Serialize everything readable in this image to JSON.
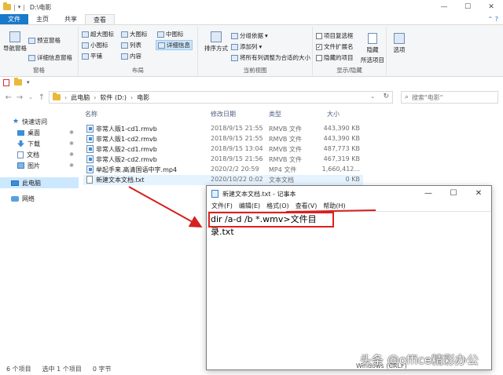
{
  "window": {
    "title": "D:\\电影"
  },
  "ribbon_tabs": [
    "文件",
    "主页",
    "共享",
    "查看"
  ],
  "ribbon": {
    "panes": {
      "nav_pane": "导航窗格",
      "preview": "预览窗格",
      "details": "详细信息窗格",
      "label": "窗格"
    },
    "layout": {
      "items": [
        "超大图标",
        "大图标",
        "中图标",
        "小图标",
        "列表",
        "详细信息",
        "平铺",
        "内容"
      ],
      "selected": "详细信息",
      "label": "布局"
    },
    "current_view": {
      "sort": "排序方式",
      "group_by": "分组依据",
      "add_column": "添加列",
      "fit_columns": "将所有列调整为合适的大小",
      "label": "当前视图"
    },
    "show_hide": {
      "item_checkbox": "项目复选框",
      "file_ext": "文件扩展名",
      "hidden_items": "隐藏的项目",
      "hide_selected": "隐藏",
      "hide_selected_2": "所选项目",
      "options": "选项",
      "label": "显示/隐藏",
      "file_ext_checked": true
    }
  },
  "address": {
    "crumbs": [
      "此电脑",
      "软件 (D:)",
      "电影"
    ],
    "search_placeholder": "搜索\"电影\""
  },
  "nav_pane": {
    "quick_access": "快速访问",
    "items": [
      "桌面",
      "下载",
      "文档",
      "图片"
    ],
    "this_pc": "此电脑",
    "network": "网络"
  },
  "columns": {
    "name": "名称",
    "date": "修改日期",
    "type": "类型",
    "size": "大小"
  },
  "files": [
    {
      "name": "非常人贩1-cd1.rmvb",
      "date": "2018/9/15 21:55",
      "type": "RMVB 文件",
      "size": "443,390 KB"
    },
    {
      "name": "非常人贩1-cd2.rmvb",
      "date": "2018/9/15 21:55",
      "type": "RMVB 文件",
      "size": "443,390 KB"
    },
    {
      "name": "非常人贩2-cd1.rmvb",
      "date": "2018/9/15 13:04",
      "type": "RMVB 文件",
      "size": "487,773 KB"
    },
    {
      "name": "非常人贩2-cd2.rmvb",
      "date": "2018/9/15 21:56",
      "type": "RMVB 文件",
      "size": "467,319 KB"
    },
    {
      "name": "举起手来.高清国语中字.mp4",
      "date": "2020/2/2 20:59",
      "type": "MP4 文件",
      "size": "1,660,412..."
    },
    {
      "name": "新建文本文档.txt",
      "date": "2020/10/22 0:02",
      "type": "文本文档",
      "size": "0 KB"
    }
  ],
  "status": {
    "count": "6 个项目",
    "selected": "选中 1 个项目",
    "size": "0 字节"
  },
  "notepad": {
    "title": "新建文本文档.txt - 记事本",
    "menu": [
      "文件(F)",
      "编辑(E)",
      "格式(O)",
      "查看(V)",
      "帮助(H)"
    ],
    "content": "dir /a-d /b *.wmv>文件目录.txt",
    "status": "Windows (CRLF)"
  },
  "watermark": "头条 @office精彩办公",
  "accent": "#1979ca",
  "highlight": "#e02020"
}
